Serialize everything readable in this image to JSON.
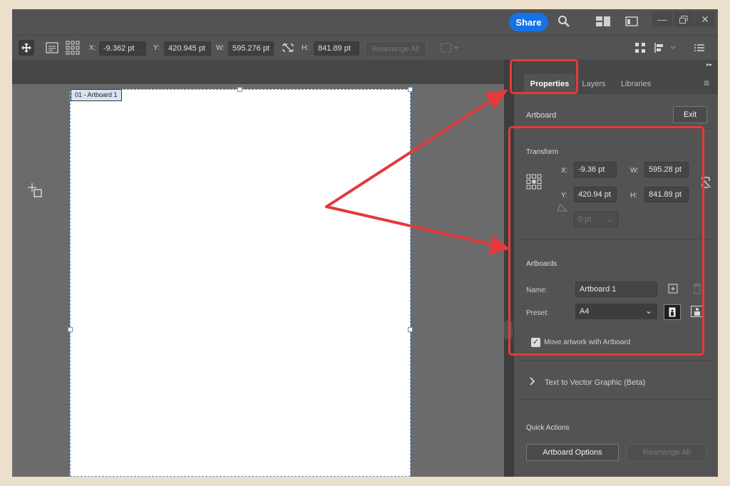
{
  "titlebar": {
    "share_label": "Share"
  },
  "optionsbar": {
    "x_label": "X:",
    "x_value": "-9.362 pt",
    "y_label": "Y:",
    "y_value": "420.945 pt",
    "w_label": "W:",
    "w_value": "595.276 pt",
    "h_label": "H:",
    "h_value": "841.89 pt",
    "rearrange_label": "Rearrange All"
  },
  "canvas": {
    "artboard_label": "01 - Artboard 1"
  },
  "panel": {
    "tabs": [
      {
        "label": "Properties",
        "active": true
      },
      {
        "label": "Layers",
        "active": false
      },
      {
        "label": "Libraries",
        "active": false
      }
    ],
    "artboard_title": "Artboard",
    "exit_label": "Exit",
    "transform": {
      "title": "Transform",
      "x_label": "X:",
      "x_value": "-9.36 pt",
      "y_label": "Y:",
      "y_value": "420.94 pt",
      "w_label": "W:",
      "w_value": "595.28 pt",
      "h_label": "H:",
      "h_value": "841.89 pt",
      "rotate_value": "0 pt"
    },
    "artboards": {
      "title": "Artboards",
      "name_label": "Name:",
      "name_value": "Artboard 1",
      "preset_label": "Preset:",
      "preset_value": "A4",
      "move_artwork_label": "Move artwork with Artboard",
      "move_artwork_checked": true
    },
    "text_to_vector_label": "Text to Vector Graphic (Beta)",
    "quick_actions": {
      "title": "Quick Actions",
      "artboard_options_label": "Artboard Options",
      "rearrange_label": "Rearrange All"
    }
  },
  "colors": {
    "accent": "#1473e6",
    "annotation": "#e33b3b",
    "panel_bg": "#535353",
    "canvas_bg": "#6b6b6b"
  }
}
